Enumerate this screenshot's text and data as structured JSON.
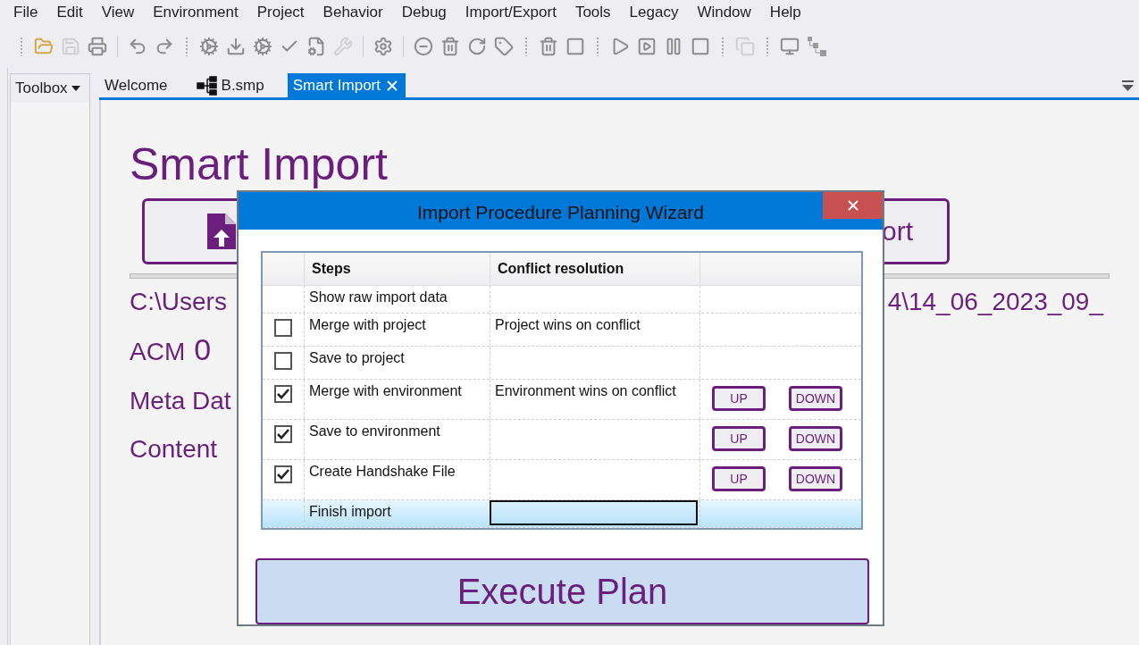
{
  "menu": [
    "File",
    "Edit",
    "View",
    "Environment",
    "Project",
    "Behavior",
    "Debug",
    "Import/Export",
    "Tools",
    "Legacy",
    "Window",
    "Help"
  ],
  "toolbox": {
    "title": "Toolbox"
  },
  "tabs": [
    {
      "label": "Welcome",
      "selected": false,
      "kind": "plain",
      "closable": false
    },
    {
      "label": "B.smp",
      "selected": false,
      "kind": "diagram",
      "closable": false
    },
    {
      "label": "Smart Import",
      "selected": true,
      "kind": "plain",
      "closable": true
    }
  ],
  "page": {
    "heading": "Smart Import",
    "buttons": [
      {
        "kind": "icon"
      },
      {
        "kind": "text",
        "label": "ort"
      }
    ],
    "path_left": "C:\\Users",
    "path_right": "4\\14_06_2023_09_",
    "fields": [
      {
        "label": "ACM",
        "value": "0"
      },
      {
        "label": "Meta Dat"
      },
      {
        "label": "Content"
      }
    ]
  },
  "dialog": {
    "title": "Import Procedure Planning Wizard",
    "columns": [
      "Steps",
      "Conflict resolution"
    ],
    "rows": [
      {
        "kind": "plain",
        "step": "Show raw import data",
        "selected": false
      },
      {
        "kind": "check",
        "checked": false,
        "step": "Merge with project",
        "conflict": "Project wins on conflict",
        "selected": false
      },
      {
        "kind": "check",
        "checked": false,
        "step": "Save to project",
        "selected": false
      },
      {
        "kind": "check",
        "checked": true,
        "step": "Merge with environment",
        "conflict": "Environment wins on conflict",
        "actions": [
          "UP",
          "DOWN"
        ],
        "selected": false
      },
      {
        "kind": "check",
        "checked": true,
        "step": "Save to environment",
        "actions": [
          "UP",
          "DOWN"
        ],
        "selected": false
      },
      {
        "kind": "check",
        "checked": true,
        "step": "Create Handshake File",
        "actions": [
          "UP",
          "DOWN"
        ],
        "selected": false
      },
      {
        "kind": "plain",
        "step": "Finish import",
        "selected": true
      }
    ],
    "execute": "Execute Plan"
  }
}
